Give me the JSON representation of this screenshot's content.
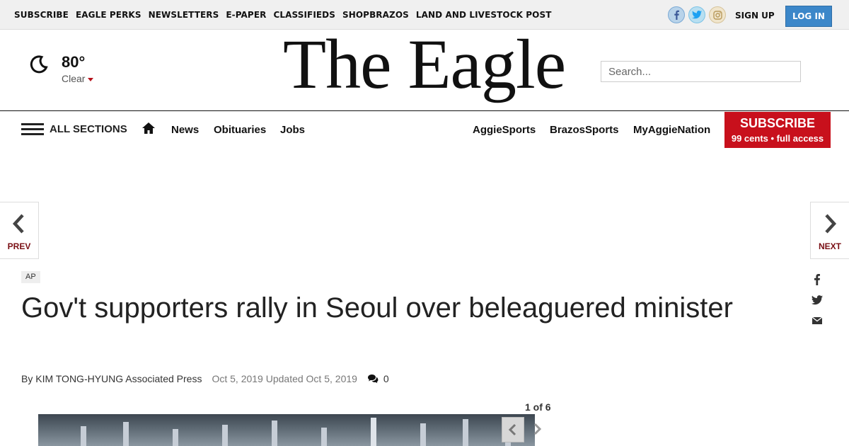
{
  "topbar": {
    "links": [
      "SUBSCRIBE",
      "EAGLE PERKS",
      "NEWSLETTERS",
      "E-PAPER",
      "CLASSIFIEDS",
      "SHOPBRAZOS",
      "LAND AND LIVESTOCK POST"
    ],
    "signup": "SIGN UP",
    "login": "LOG IN",
    "social_icons": [
      "facebook-icon",
      "twitter-icon",
      "instagram-icon"
    ]
  },
  "weather": {
    "icon": "moon-icon",
    "temperature": "80°",
    "condition": "Clear"
  },
  "masthead": {
    "logo": "The Eagle",
    "search_placeholder": "Search..."
  },
  "nav": {
    "all_sections": "ALL SECTIONS",
    "left_links": [
      "News",
      "Obituaries",
      "Jobs"
    ],
    "right_links": [
      "AggieSports",
      "BrazosSports",
      "MyAggieNation"
    ],
    "subscribe_title": "SUBSCRIBE",
    "subscribe_sub": "99 cents • full access"
  },
  "pager": {
    "prev": "PREV",
    "next": "NEXT"
  },
  "article": {
    "tag": "AP",
    "headline": "Gov't supporters rally in Seoul over beleaguered minister",
    "byline": "By KIM TONG-HYUNG Associated Press",
    "dates": "Oct 5, 2019 Updated Oct 5, 2019",
    "comment_count": "0",
    "share_icons": [
      "facebook-icon",
      "twitter-icon",
      "email-icon"
    ]
  },
  "gallery": {
    "count": "1 of 6"
  },
  "colors": {
    "accent_red": "#c8101c",
    "login_blue": "#3c87c9",
    "pager_label": "#7a0f14"
  }
}
